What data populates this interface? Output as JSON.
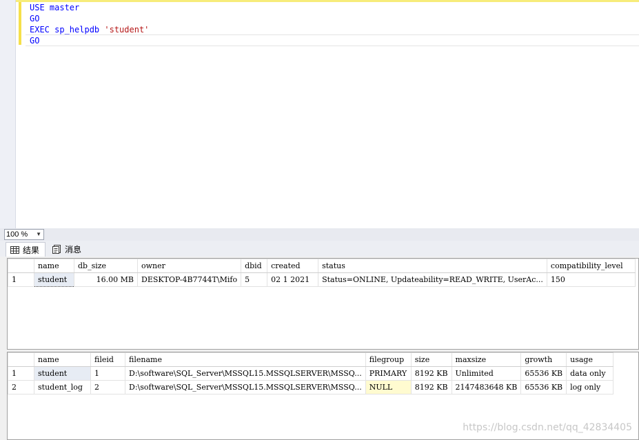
{
  "editor": {
    "lines": [
      {
        "keyword": "USE master",
        "string": ""
      },
      {
        "keyword": "GO",
        "string": ""
      },
      {
        "keyword": "EXEC sp_helpdb ",
        "string": "'student'"
      },
      {
        "keyword": "GO",
        "string": ""
      }
    ]
  },
  "zoom": {
    "value": "100 %"
  },
  "tabs": [
    {
      "label": "结果",
      "icon": "grid-icon"
    },
    {
      "label": "消息",
      "icon": "message-icon"
    }
  ],
  "grid1": {
    "columns": [
      "name",
      "db_size",
      "owner",
      "dbid",
      "created",
      "status",
      "compatibility_level"
    ],
    "rows": [
      {
        "rownum": "1",
        "cells": [
          "student",
          "16.00 MB",
          "DESKTOP-4B7744T\\Mifo",
          "5",
          "02  1 2021",
          "Status=ONLINE, Updateability=READ_WRITE, UserAc...",
          "150"
        ]
      }
    ]
  },
  "grid2": {
    "columns": [
      "name",
      "fileid",
      "filename",
      "filegroup",
      "size",
      "maxsize",
      "growth",
      "usage"
    ],
    "rows": [
      {
        "rownum": "1",
        "cells": [
          "student",
          "1",
          "D:\\software\\SQL_Server\\MSSQL15.MSSQLSERVER\\MSSQ...",
          "PRIMARY",
          "8192 KB",
          "Unlimited",
          "65536 KB",
          "data only"
        ]
      },
      {
        "rownum": "2",
        "cells": [
          "student_log",
          "2",
          "D:\\software\\SQL_Server\\MSSQL15.MSSQLSERVER\\MSSQ...",
          "NULL",
          "8192 KB",
          "2147483648 KB",
          "65536 KB",
          "log only"
        ]
      }
    ]
  },
  "watermark": "https://blog.csdn.net/qq_42834405"
}
